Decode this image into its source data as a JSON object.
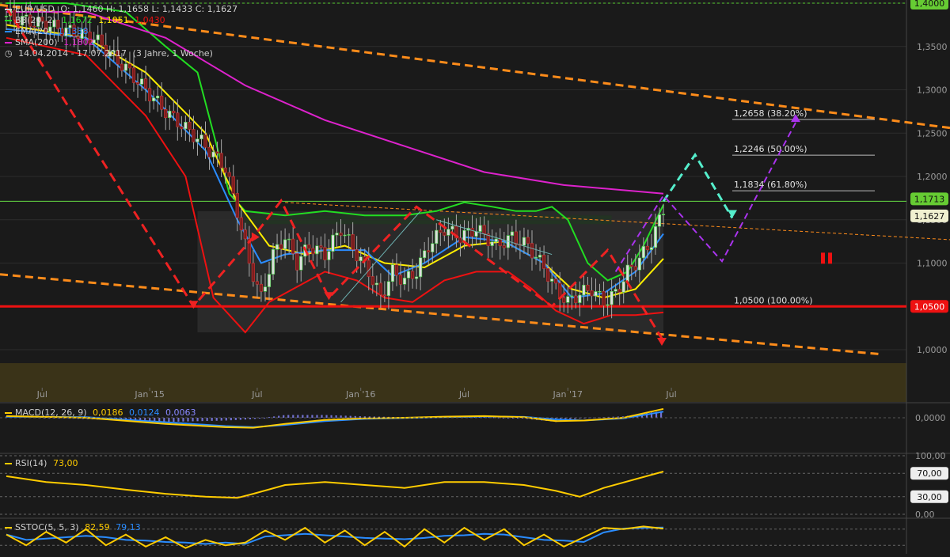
{
  "header": {
    "symbol": "EUR/USD",
    "ohlc": "O: 1,1460  H: 1,1658  L: 1,1433  C: 1,1627",
    "bb_label": "BB(20, 2)",
    "bb_upper": "1,1672",
    "bb_mid": "1,1051",
    "bb_lower": "1,0430",
    "ema_label": "EMA(20)",
    "ema_value": "1,1338",
    "sma_label": "SMA(200)",
    "sma_value": "1,1802",
    "period": "14.04.2014 - 17.07.2017",
    "period_note": "(3 Jahre, 1 Woche)"
  },
  "colors": {
    "background": "#1a1a1a",
    "bb_band": "#22dd22",
    "bb_mid": "#ffee00",
    "bb_lower": "#ee1111",
    "ema": "#2a8cff",
    "sma": "#dd22cc",
    "trend": "#ff8c1a",
    "support": "#ee1111",
    "resistance": "#66dd44",
    "projection_up": "#55eecc",
    "projection_down": "#aa33ee",
    "macd": "#ffcc00",
    "signal": "#2a8cff",
    "hist": "#8888ff"
  },
  "chart_data": [
    {
      "type": "candlestick",
      "title": "EUR/USD",
      "x": [
        "Jul",
        "Jan '15",
        "Jul",
        "Jan '16",
        "Jul",
        "Jan '17",
        "Jul"
      ],
      "y_ticks": [
        "1,4000",
        "1,3500",
        "1,3000",
        "1,2500",
        "1,2000",
        "1,1500",
        "1,1000",
        "1,0500",
        "1,0000"
      ],
      "ylim": [
        0.965,
        1.4
      ],
      "price_path": [
        [
          0,
          1.385
        ],
        [
          10,
          1.375
        ],
        [
          22,
          1.36
        ],
        [
          31,
          1.32
        ],
        [
          40,
          1.275
        ],
        [
          49,
          1.24
        ],
        [
          55,
          1.21
        ],
        [
          58,
          1.16
        ],
        [
          61,
          1.1
        ],
        [
          64,
          1.06
        ],
        [
          67,
          1.11
        ],
        [
          70,
          1.13
        ],
        [
          73,
          1.1
        ],
        [
          76,
          1.12
        ],
        [
          80,
          1.11
        ],
        [
          84,
          1.14
        ],
        [
          88,
          1.11
        ],
        [
          91,
          1.09
        ],
        [
          94,
          1.06
        ],
        [
          97,
          1.09
        ],
        [
          100,
          1.08
        ],
        [
          103,
          1.09
        ],
        [
          106,
          1.12
        ],
        [
          110,
          1.14
        ],
        [
          114,
          1.13
        ],
        [
          118,
          1.14
        ],
        [
          123,
          1.12
        ],
        [
          127,
          1.13
        ],
        [
          131,
          1.12
        ],
        [
          135,
          1.095
        ],
        [
          138,
          1.07
        ],
        [
          141,
          1.055
        ],
        [
          144,
          1.065
        ],
        [
          147,
          1.07
        ],
        [
          150,
          1.055
        ],
        [
          153,
          1.065
        ],
        [
          156,
          1.09
        ],
        [
          159,
          1.105
        ],
        [
          162,
          1.125
        ],
        [
          165,
          1.1627
        ]
      ],
      "ema": [
        [
          0,
          1.37
        ],
        [
          20,
          1.36
        ],
        [
          35,
          1.3
        ],
        [
          50,
          1.23
        ],
        [
          58,
          1.15
        ],
        [
          64,
          1.1
        ],
        [
          70,
          1.11
        ],
        [
          80,
          1.115
        ],
        [
          90,
          1.115
        ],
        [
          97,
          1.085
        ],
        [
          105,
          1.1
        ],
        [
          115,
          1.13
        ],
        [
          125,
          1.125
        ],
        [
          135,
          1.1
        ],
        [
          142,
          1.06
        ],
        [
          150,
          1.065
        ],
        [
          158,
          1.09
        ],
        [
          165,
          1.1338
        ]
      ],
      "bb_mid": [
        [
          0,
          1.375
        ],
        [
          20,
          1.36
        ],
        [
          35,
          1.32
        ],
        [
          50,
          1.25
        ],
        [
          58,
          1.17
        ],
        [
          66,
          1.12
        ],
        [
          75,
          1.11
        ],
        [
          85,
          1.12
        ],
        [
          95,
          1.1
        ],
        [
          105,
          1.095
        ],
        [
          115,
          1.12
        ],
        [
          125,
          1.125
        ],
        [
          135,
          1.1
        ],
        [
          142,
          1.07
        ],
        [
          150,
          1.06
        ],
        [
          158,
          1.07
        ],
        [
          165,
          1.1051
        ]
      ],
      "bb_upper": [
        [
          0,
          1.4
        ],
        [
          15,
          1.4
        ],
        [
          30,
          1.39
        ],
        [
          40,
          1.35
        ],
        [
          48,
          1.32
        ],
        [
          52,
          1.25
        ],
        [
          56,
          1.18
        ],
        [
          60,
          1.16
        ],
        [
          70,
          1.155
        ],
        [
          80,
          1.16
        ],
        [
          90,
          1.155
        ],
        [
          100,
          1.155
        ],
        [
          108,
          1.16
        ],
        [
          115,
          1.17
        ],
        [
          122,
          1.165
        ],
        [
          128,
          1.16
        ],
        [
          133,
          1.16
        ],
        [
          137,
          1.165
        ],
        [
          141,
          1.15
        ],
        [
          146,
          1.1
        ],
        [
          151,
          1.08
        ],
        [
          156,
          1.09
        ],
        [
          160,
          1.12
        ],
        [
          165,
          1.1672
        ]
      ],
      "bb_lower": [
        [
          0,
          1.36
        ],
        [
          20,
          1.34
        ],
        [
          35,
          1.27
        ],
        [
          45,
          1.2
        ],
        [
          52,
          1.06
        ],
        [
          55,
          1.045
        ],
        [
          60,
          1.02
        ],
        [
          66,
          1.055
        ],
        [
          72,
          1.07
        ],
        [
          80,
          1.09
        ],
        [
          88,
          1.08
        ],
        [
          95,
          1.06
        ],
        [
          102,
          1.055
        ],
        [
          110,
          1.08
        ],
        [
          118,
          1.09
        ],
        [
          126,
          1.09
        ],
        [
          132,
          1.07
        ],
        [
          138,
          1.045
        ],
        [
          145,
          1.03
        ],
        [
          152,
          1.04
        ],
        [
          158,
          1.04
        ],
        [
          165,
          1.043
        ]
      ],
      "sma200": [
        [
          0,
          1.39
        ],
        [
          20,
          1.39
        ],
        [
          40,
          1.36
        ],
        [
          60,
          1.305
        ],
        [
          80,
          1.265
        ],
        [
          100,
          1.235
        ],
        [
          120,
          1.205
        ],
        [
          140,
          1.19
        ],
        [
          165,
          1.1802
        ]
      ],
      "levels": [
        {
          "label": "1,2658 (38.20%)",
          "value": 1.2658
        },
        {
          "label": "1,2246 (50.00%)",
          "value": 1.2246
        },
        {
          "label": "1,1834 (61.80%)",
          "value": 1.1834
        },
        {
          "label": "1,0500 (100.00%)",
          "value": 1.05
        }
      ],
      "price_tags": [
        {
          "label": "1,4000",
          "value": 1.4
        },
        {
          "label": "1,1713",
          "value": 1.1713
        },
        {
          "label": "1,1627",
          "value": 1.1627
        },
        {
          "label": "1,0500",
          "value": 1.05
        }
      ]
    },
    {
      "type": "line",
      "title": "MACD(12, 26, 9)",
      "values_label": [
        "0,0186",
        "0,0124",
        "0,0063"
      ],
      "y_ticks": [
        "0,0000"
      ],
      "macd": [
        [
          0,
          0.15
        ],
        [
          20,
          0.0
        ],
        [
          40,
          -0.55
        ],
        [
          55,
          -0.85
        ],
        [
          62,
          -0.9
        ],
        [
          70,
          -0.55
        ],
        [
          80,
          -0.2
        ],
        [
          90,
          -0.05
        ],
        [
          100,
          0.0
        ],
        [
          110,
          0.1
        ],
        [
          120,
          0.15
        ],
        [
          130,
          0.05
        ],
        [
          138,
          -0.3
        ],
        [
          145,
          -0.25
        ],
        [
          155,
          0.0
        ],
        [
          165,
          0.8
        ]
      ],
      "signal": [
        [
          0,
          0.1
        ],
        [
          20,
          0.05
        ],
        [
          40,
          -0.4
        ],
        [
          55,
          -0.75
        ],
        [
          62,
          -0.85
        ],
        [
          70,
          -0.65
        ],
        [
          80,
          -0.3
        ],
        [
          90,
          -0.1
        ],
        [
          100,
          -0.02
        ],
        [
          110,
          0.05
        ],
        [
          120,
          0.12
        ],
        [
          130,
          0.08
        ],
        [
          138,
          -0.15
        ],
        [
          145,
          -0.25
        ],
        [
          155,
          -0.05
        ],
        [
          165,
          0.55
        ]
      ]
    },
    {
      "type": "line",
      "title": "RSI(14)",
      "value_label": "73,00",
      "y_ticks": [
        "100,00",
        "70,00",
        "30,00",
        "0,00"
      ],
      "values": [
        [
          0,
          65
        ],
        [
          10,
          55
        ],
        [
          20,
          50
        ],
        [
          30,
          42
        ],
        [
          40,
          35
        ],
        [
          50,
          30
        ],
        [
          58,
          28
        ],
        [
          62,
          35
        ],
        [
          70,
          50
        ],
        [
          80,
          55
        ],
        [
          90,
          50
        ],
        [
          100,
          45
        ],
        [
          110,
          55
        ],
        [
          120,
          55
        ],
        [
          130,
          50
        ],
        [
          138,
          40
        ],
        [
          144,
          30
        ],
        [
          150,
          45
        ],
        [
          158,
          60
        ],
        [
          165,
          73
        ]
      ]
    },
    {
      "type": "line",
      "title": "SSTOC(5, 5, 3)",
      "values_label": [
        "82,59",
        "79,13"
      ],
      "values": [
        [
          0,
          60
        ],
        [
          5,
          20
        ],
        [
          10,
          70
        ],
        [
          15,
          30
        ],
        [
          20,
          80
        ],
        [
          25,
          20
        ],
        [
          30,
          60
        ],
        [
          35,
          15
        ],
        [
          40,
          50
        ],
        [
          45,
          10
        ],
        [
          50,
          40
        ],
        [
          55,
          20
        ],
        [
          60,
          30
        ],
        [
          65,
          75
        ],
        [
          70,
          40
        ],
        [
          75,
          85
        ],
        [
          80,
          30
        ],
        [
          85,
          75
        ],
        [
          90,
          20
        ],
        [
          95,
          70
        ],
        [
          100,
          15
        ],
        [
          105,
          80
        ],
        [
          110,
          30
        ],
        [
          115,
          85
        ],
        [
          120,
          40
        ],
        [
          125,
          80
        ],
        [
          130,
          20
        ],
        [
          135,
          60
        ],
        [
          140,
          15
        ],
        [
          145,
          50
        ],
        [
          150,
          85
        ],
        [
          155,
          80
        ],
        [
          160,
          90
        ],
        [
          165,
          82
        ]
      ]
    }
  ]
}
